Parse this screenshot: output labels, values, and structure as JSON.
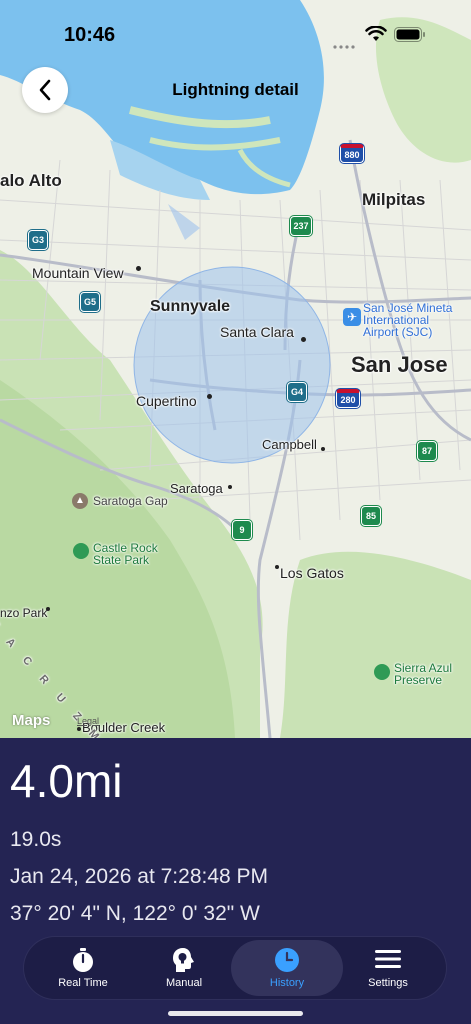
{
  "status_bar": {
    "time": "10:46"
  },
  "header": {
    "title": "Lightning detail"
  },
  "map": {
    "places": {
      "palo_alto": "alo Alto",
      "milpitas": "Milpitas",
      "mountain_view": "Mountain View",
      "sunnyvale": "Sunnyvale",
      "santa_clara": "Santa Clara",
      "san_jose": "San Jose",
      "airport": "San José Mineta\nInternational\nAirport (SJC)",
      "cupertino": "Cupertino",
      "campbell": "Campbell",
      "saratoga": "Saratoga",
      "saratoga_gap": "Saratoga Gap",
      "castle_rock": "Castle Rock\nState Park",
      "los_gatos": "Los Gatos",
      "enzo_park": "nzo Park",
      "sierra_azul": "Sierra Azul\nPreserve",
      "boulder_creek": "Boulder Creek",
      "range": "N T A  C R U Z  M O U N T A I N S"
    },
    "shields": {
      "s880": "880",
      "s237": "237",
      "sG3": "G3",
      "sG5": "G5",
      "sG4": "G4",
      "s280": "280",
      "s87": "87",
      "s85": "85",
      "s9": "9"
    },
    "attribution": "Maps",
    "legal": "Legal"
  },
  "detail": {
    "distance": "4.0mi",
    "elapsed": "19.0s",
    "datetime": "Jan 24, 2026 at 7:28:48 PM",
    "coordinates": "37° 20' 4\" N, 122° 0' 32\" W"
  },
  "tabs": [
    {
      "label": "Real Time",
      "icon": "stopwatch-icon"
    },
    {
      "label": "Manual",
      "icon": "head-lightbulb-icon"
    },
    {
      "label": "History",
      "icon": "clock-icon",
      "active": true
    },
    {
      "label": "Settings",
      "icon": "menu-icon"
    }
  ],
  "colors": {
    "accent": "#3aa0ff",
    "panel": "#242453",
    "water": "#7cc1ee",
    "range_circle": "#9ec2ec"
  }
}
